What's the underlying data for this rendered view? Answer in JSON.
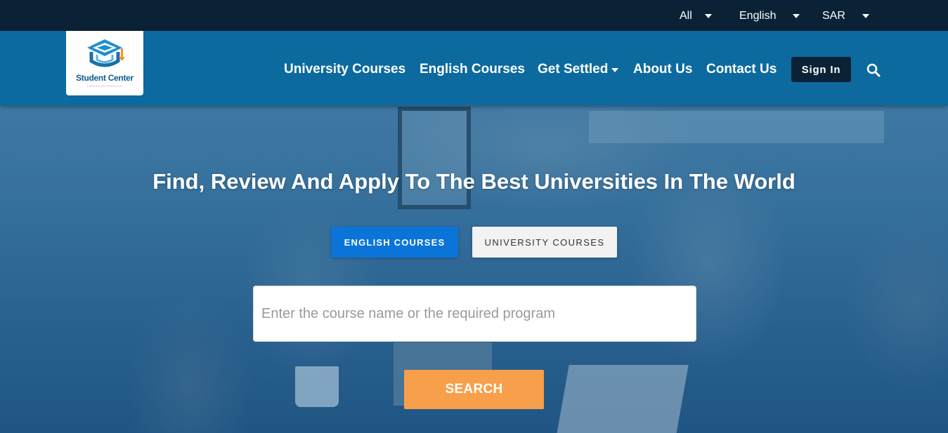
{
  "topbar": {
    "category_select": "All",
    "language_select": "English",
    "currency_select": "SAR"
  },
  "logo": {
    "name": "Student Center",
    "tagline": "EDUCATION SERVICES",
    "icon": "graduation-cap-logo-icon"
  },
  "nav": {
    "items": [
      {
        "label": "University Courses"
      },
      {
        "label": "English Courses"
      },
      {
        "label": "Get Settled",
        "icon": "chevron-down-icon"
      },
      {
        "label": "About Us"
      },
      {
        "label": "Contact Us"
      }
    ],
    "sign_in": "Sign In",
    "search_icon": "search-icon"
  },
  "hero": {
    "title": "Find, Review And Apply To The Best Universities In The World",
    "tabs": [
      {
        "label": "ENGLISH COURSES",
        "active": true
      },
      {
        "label": "UNIVERSITY COURSES",
        "active": false
      }
    ],
    "search": {
      "placeholder": "Enter the course name or the required program",
      "value": ""
    },
    "search_button": "SEARCH"
  },
  "colors": {
    "topbar_bg": "#0b2236",
    "navbar_bg": "#0c6a9f",
    "signin_bg": "#0b2236",
    "active_tab": "#0b74d9",
    "inactive_tab": "#f2f2f2",
    "search_button": "#f79f4a"
  }
}
